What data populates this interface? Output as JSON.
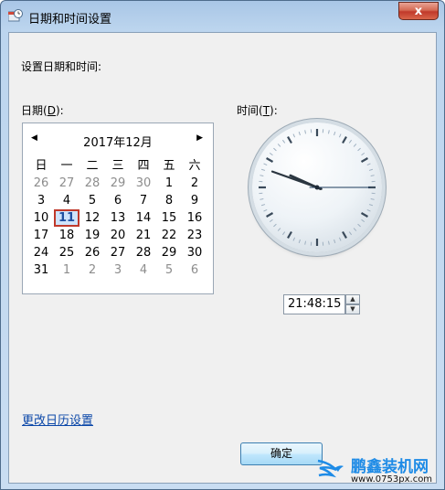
{
  "window": {
    "title": "日期和时间设置",
    "close_label": "x"
  },
  "heading": "设置日期和时间:",
  "date_label": {
    "text": "日期(",
    "mnemonic": "D",
    "suffix": "):"
  },
  "time_label": {
    "text": "时间(",
    "mnemonic": "T",
    "suffix": "):"
  },
  "calendar": {
    "title": "2017年12月",
    "prev": "◀",
    "next": "▶",
    "weekdays": [
      "日",
      "一",
      "二",
      "三",
      "四",
      "五",
      "六"
    ],
    "weeks": [
      [
        {
          "d": "26",
          "o": true
        },
        {
          "d": "27",
          "o": true
        },
        {
          "d": "28",
          "o": true
        },
        {
          "d": "29",
          "o": true
        },
        {
          "d": "30",
          "o": true
        },
        {
          "d": "1"
        },
        {
          "d": "2"
        }
      ],
      [
        {
          "d": "3"
        },
        {
          "d": "4"
        },
        {
          "d": "5"
        },
        {
          "d": "6"
        },
        {
          "d": "7"
        },
        {
          "d": "8"
        },
        {
          "d": "9"
        }
      ],
      [
        {
          "d": "10"
        },
        {
          "d": "11",
          "sel": true
        },
        {
          "d": "12"
        },
        {
          "d": "13"
        },
        {
          "d": "14"
        },
        {
          "d": "15"
        },
        {
          "d": "16"
        }
      ],
      [
        {
          "d": "17"
        },
        {
          "d": "18"
        },
        {
          "d": "19"
        },
        {
          "d": "20"
        },
        {
          "d": "21"
        },
        {
          "d": "22"
        },
        {
          "d": "23"
        }
      ],
      [
        {
          "d": "24"
        },
        {
          "d": "25"
        },
        {
          "d": "26"
        },
        {
          "d": "27"
        },
        {
          "d": "28"
        },
        {
          "d": "29"
        },
        {
          "d": "30"
        }
      ],
      [
        {
          "d": "31"
        },
        {
          "d": "1",
          "o": true
        },
        {
          "d": "2",
          "o": true
        },
        {
          "d": "3",
          "o": true
        },
        {
          "d": "4",
          "o": true
        },
        {
          "d": "5",
          "o": true
        },
        {
          "d": "6",
          "o": true
        }
      ]
    ]
  },
  "clock": {
    "hour": 21,
    "minute": 48,
    "second": 15
  },
  "time_value": "21:48:15",
  "link_text": "更改日历设置",
  "ok_label": "确定",
  "watermark": {
    "brand": "鹏鑫装机网",
    "url": "www.0753px.com"
  },
  "colors": {
    "selected_border": "#c0392b",
    "link": "#0b47a8"
  }
}
